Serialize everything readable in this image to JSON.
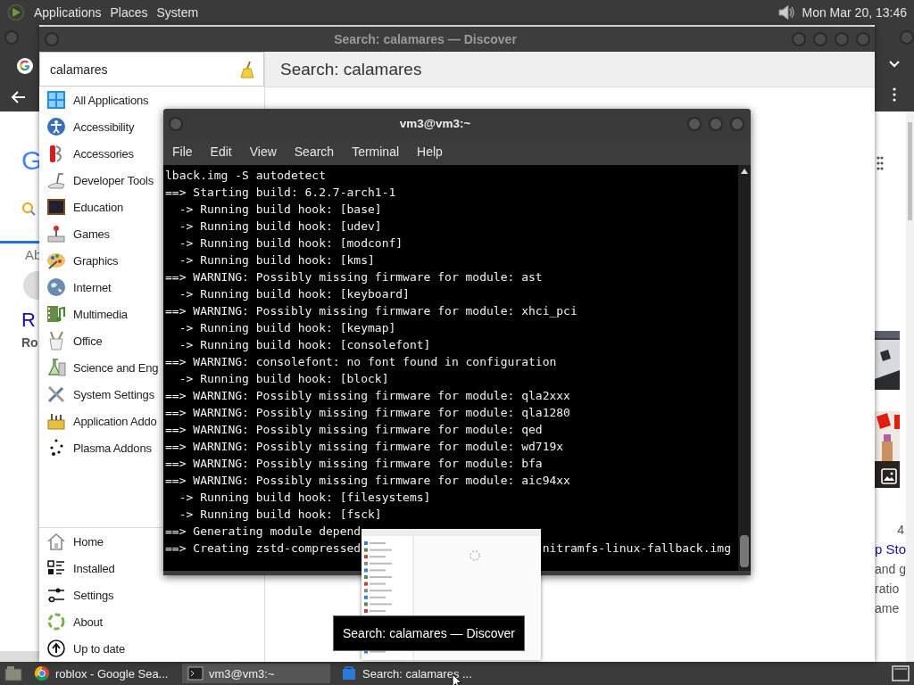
{
  "top_panel": {
    "menus": [
      "Applications",
      "Places",
      "System"
    ],
    "clock": "Mon Mar 20, 13:46"
  },
  "browser": {
    "left_fragments": [
      {
        "kind": "logo",
        "text": "G"
      },
      {
        "kind": "tab",
        "text": "Ab"
      },
      {
        "kind": "title",
        "text": "R"
      },
      {
        "kind": "subtitle",
        "text": "Ro"
      }
    ],
    "right_fragments": [
      {
        "kind": "meta",
        "text": "4"
      },
      {
        "kind": "link",
        "text": "p Sto"
      },
      {
        "kind": "snippet",
        "text": "and g"
      },
      {
        "kind": "snippet",
        "text": "ratio"
      },
      {
        "kind": "snippet",
        "text": "ame"
      }
    ]
  },
  "discover": {
    "title": "Search: calamares — Discover",
    "search": {
      "value": "calamares"
    },
    "heading": "Search: calamares",
    "categories": [
      "All Applications",
      "Accessibility",
      "Accessories",
      "Developer Tools",
      "Education",
      "Games",
      "Graphics",
      "Internet",
      "Multimedia",
      "Office",
      "Science and Eng",
      "System Settings",
      "Application Addo",
      "Plasma Addons"
    ],
    "nav": [
      "Home",
      "Installed",
      "Settings",
      "About",
      "Up to date"
    ]
  },
  "terminal": {
    "title": "vm3@vm3:~",
    "menus": [
      "File",
      "Edit",
      "View",
      "Search",
      "Terminal",
      "Help"
    ],
    "lines": [
      {
        "text": "lback.img -S autodetect"
      },
      {
        "text": "==> Starting build: 6.2.7-arch1-1"
      },
      {
        "text": "  -> Running build hook: [base]"
      },
      {
        "text": "  -> Running build hook: [udev]"
      },
      {
        "text": "  -> Running build hook: [modconf]"
      },
      {
        "text": "  -> Running build hook: [kms]"
      },
      {
        "text": "==> WARNING: Possibly missing firmware for module: ast"
      },
      {
        "text": "  -> Running build hook: [keyboard]"
      },
      {
        "text": "==> WARNING: Possibly missing firmware for module: xhci_pci"
      },
      {
        "text": "  -> Running build hook: [keymap]"
      },
      {
        "text": "  -> Running build hook: [consolefont]"
      },
      {
        "text": "==> WARNING: consolefont: no font found in configuration"
      },
      {
        "text": "  -> Running build hook: [block]"
      },
      {
        "text": "==> WARNING: Possibly missing firmware for module: qla2xxx"
      },
      {
        "text": "==> WARNING: Possibly missing firmware for module: qla1280"
      },
      {
        "text": "==> WARNING: Possibly missing firmware for module: qed"
      },
      {
        "text": "==> WARNING: Possibly missing firmware for module: wd719x"
      },
      {
        "text": "==> WARNING: Possibly missing firmware for module: bfa"
      },
      {
        "text": "==> WARNING: Possibly missing firmware for module: aic94xx"
      },
      {
        "text": "  -> Running build hook: [filesystems]"
      },
      {
        "text": "  -> Running build hook: [fsck]"
      },
      {
        "text": "==> Generating module depend"
      },
      {
        "text": "==> Creating zstd-compressed",
        "tail": "nitramfs-linux-fallback.img"
      }
    ]
  },
  "tooltip": "Search: calamares — Discover",
  "taskbar": {
    "tasks": [
      {
        "label": "roblox - Google Sea...",
        "selected": false
      },
      {
        "label": "vm3@vm3:~",
        "selected": true
      },
      {
        "label": "Search: calamares ...",
        "selected": false
      }
    ]
  }
}
